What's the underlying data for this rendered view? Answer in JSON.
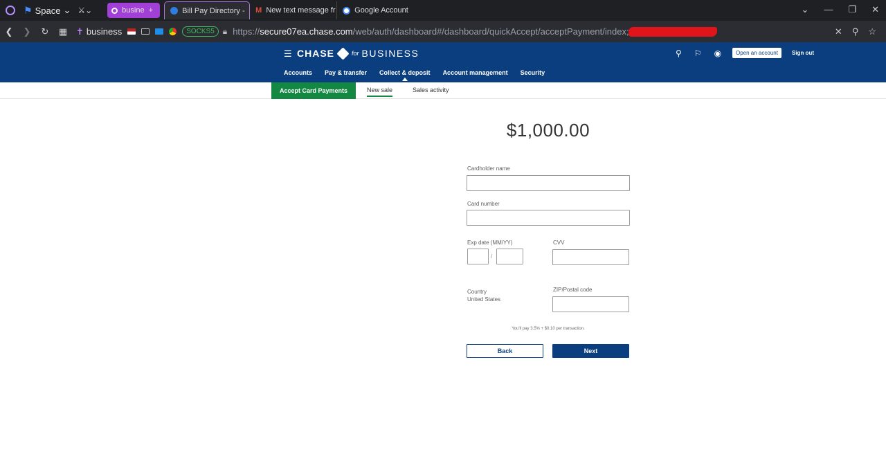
{
  "browser": {
    "space_label": "Space",
    "tab_group_label": "busine",
    "tabs": [
      {
        "label": "Bill Pay Directory -"
      },
      {
        "label": "New text message fr"
      },
      {
        "label": "Google Account"
      }
    ],
    "workspace_label": "business",
    "proxy_badge": "SOCKS5",
    "url_prefix": "https://",
    "url_host": "secure07ea.chase.com",
    "url_path": "/web/auth/dashboard#/dashboard/quickAccept/acceptPayment/index;accountT"
  },
  "chase": {
    "logo_chase": "CHASE",
    "logo_for": "for",
    "logo_business": "BUSINESS",
    "open_account_label": "Open an account",
    "sign_out_label": "Sign out",
    "nav": [
      "Accounts",
      "Pay & transfer",
      "Collect & deposit",
      "Account management",
      "Security"
    ]
  },
  "subnav": {
    "primary_label": "Accept Card Payments",
    "new_sale_label": "New sale",
    "sales_activity_label": "Sales activity"
  },
  "form": {
    "amount": "$1,000.00",
    "cardholder_label": "Cardholder name",
    "card_number_label": "Card number",
    "exp_label": "Exp date (MM/YY)",
    "exp_sep": "/",
    "cvv_label": "CVV",
    "country_label": "Country",
    "country_value": "United States",
    "zip_label": "ZIP/Postal code",
    "fee_note": "You'll pay 3.5% + $0.10 per transaction.",
    "back_label": "Back",
    "next_label": "Next"
  },
  "colors": {
    "chase_blue": "#0b3e7e",
    "accept_green": "#128842",
    "tab_group_purple": "#a23fd6",
    "redaction_red": "#e0141b"
  }
}
